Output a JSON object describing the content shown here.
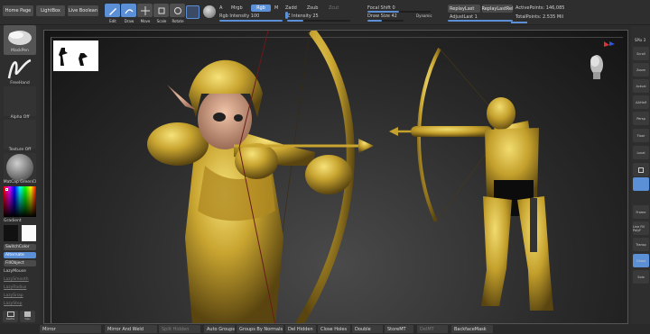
{
  "top": {
    "home_page": "Home Page",
    "lightbox": "LightBox",
    "live_boolean": "Live Boolean",
    "tools": [
      "Edit",
      "Draw",
      "Move",
      "Scale",
      "Rotate"
    ],
    "a_label": "A",
    "mrgb": "Mrgb",
    "rgb": "Rgb",
    "m": "M",
    "zadd": "Zadd",
    "zsub": "Zsub",
    "zcut": "Zcut",
    "rgb_intensity": "Rgb Intensity 100",
    "z_intensity": "Z Intensity 25",
    "focal_shift": "Focal Shift 0",
    "draw_size": "Draw Size 42",
    "dynamic": "Dynamic",
    "replay_last": "ReplayLast",
    "replay_last_rel": "ReplayLastRel",
    "adjust_last": "AdjustLast 1",
    "active_points": "ActivePoints: 146,085",
    "total_points": "TotalPoints: 2.535 Mil"
  },
  "left": {
    "brush": "MaskPen",
    "stroke": "FreeHand",
    "alpha": "Alpha Off",
    "texture": "Texture Off",
    "material": "MatCap GreenCl",
    "gradient": "Gradient",
    "switch_color": "SwitchColor",
    "alternate": "Alternate",
    "fill_object": "FillObject",
    "lazy_mouse": "LazyMouse",
    "lazy_smooth": "LazySmooth",
    "lazy_radius": "LazyRadius",
    "lazy_snap": "LazySnap",
    "lazy_step": "LazyStep",
    "bottom_icons": [
      "Cache",
      "Cpu"
    ]
  },
  "right": {
    "spix": "SPix 3",
    "buttons": [
      "Scroll",
      "Zoom",
      "Actual",
      "AAHalf",
      "Persp",
      "Floor",
      "Local",
      "",
      "Frame",
      "Line Fill PolyF",
      "Transp",
      "Ghost",
      "Solo"
    ]
  },
  "bottom": {
    "mirror": "Mirror",
    "mirror_weld": "Mirror And Weld",
    "split_hidden": "Split Hidden",
    "auto_groups": "Auto Groups",
    "groups_by_normals": "Groups By Normals",
    "del_hidden": "Del Hidden",
    "close_holes": "Close Holes",
    "double": "Double",
    "store_mt": "StoreMT",
    "del_mt": "DelMT",
    "backface_mask": "BackfaceMask"
  },
  "colors": {
    "accent": "#5b8fd6",
    "gold": "#c9a530",
    "panel": "#2b2b2b"
  }
}
